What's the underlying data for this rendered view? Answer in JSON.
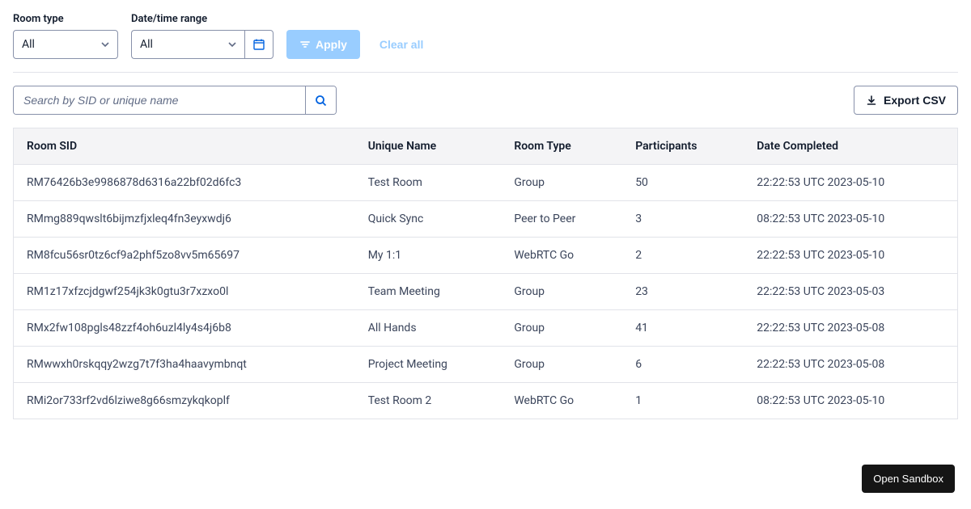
{
  "filters": {
    "room_type": {
      "label": "Room type",
      "value": "All"
    },
    "datetime": {
      "label": "Date/time range",
      "value": "All"
    },
    "apply_label": "Apply",
    "clear_label": "Clear all"
  },
  "toolbar": {
    "search_placeholder": "Search by SID or unique name",
    "export_label": "Export CSV"
  },
  "table": {
    "columns": [
      "Room SID",
      "Unique Name",
      "Room Type",
      "Participants",
      "Date Completed"
    ],
    "rows": [
      {
        "sid": "RM76426b3e9986878d6316a22bf02d6fc3",
        "name": "Test Room",
        "type": "Group",
        "participants": "50",
        "completed": "22:22:53 UTC 2023-05-10"
      },
      {
        "sid": "RMmg889qwslt6bijmzfjxleq4fn3eyxwdj6",
        "name": "Quick Sync",
        "type": "Peer to Peer",
        "participants": "3",
        "completed": "08:22:53 UTC 2023-05-10"
      },
      {
        "sid": "RM8fcu56sr0tz6cf9a2phf5zo8vv5m65697",
        "name": "My 1:1",
        "type": "WebRTC Go",
        "participants": "2",
        "completed": "22:22:53 UTC 2023-05-10"
      },
      {
        "sid": "RM1z17xfzcjdgwf254jk3k0gtu3r7xzxo0l",
        "name": "Team Meeting",
        "type": "Group",
        "participants": "23",
        "completed": "22:22:53 UTC 2023-05-03"
      },
      {
        "sid": "RMx2fw108pgls48zzf4oh6uzl4ly4s4j6b8",
        "name": "All Hands",
        "type": "Group",
        "participants": "41",
        "completed": "22:22:53 UTC 2023-05-08"
      },
      {
        "sid": "RMwwxh0rskqqy2wzg7t7f3ha4haavymbnqt",
        "name": "Project Meeting",
        "type": "Group",
        "participants": "6",
        "completed": "22:22:53 UTC 2023-05-08"
      },
      {
        "sid": "RMi2or733rf2vd6lziwe8g66smzykqkoplf",
        "name": "Test Room 2",
        "type": "WebRTC Go",
        "participants": "1",
        "completed": "08:22:53 UTC 2023-05-10"
      }
    ]
  },
  "sandbox_label": "Open Sandbox"
}
